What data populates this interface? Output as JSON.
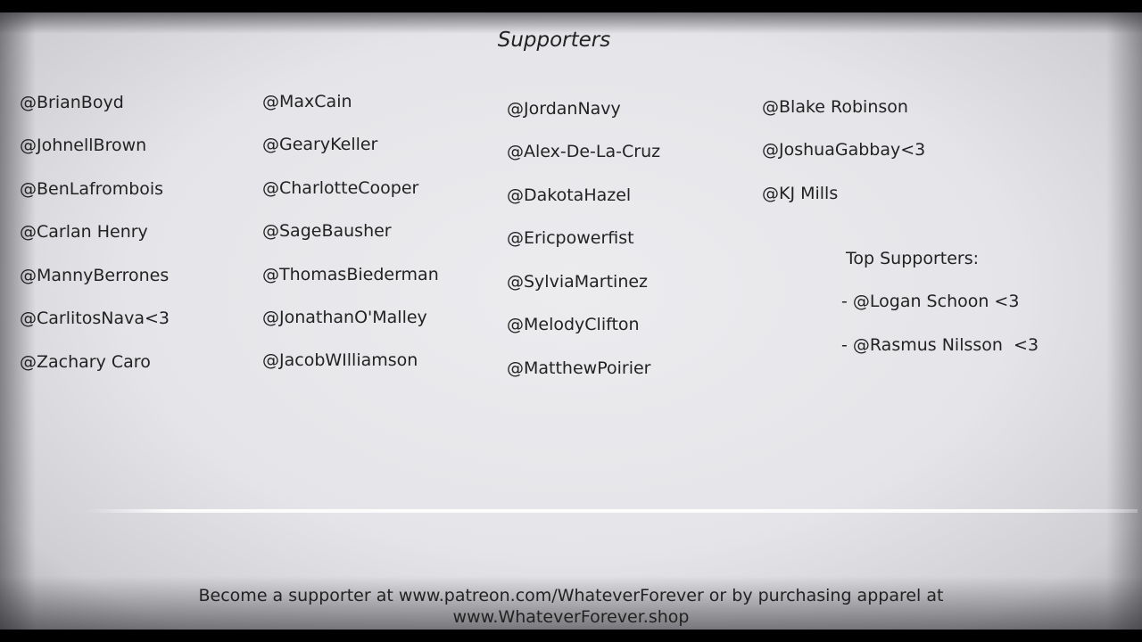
{
  "title": "Supporters",
  "columns": [
    [
      "@BrianBoyd",
      "@JohnellBrown",
      "@BenLafrombois",
      "@Carlan Henry",
      "@MannyBerrones",
      "@CarlitosNava<3",
      "@Zachary Caro"
    ],
    [
      "@MaxCain",
      "@GearyKeller",
      "@CharlotteCooper",
      "@SageBausher",
      "@ThomasBiederman",
      "@JonathanO'Malley",
      "@JacobWIlliamson"
    ],
    [
      "@JordanNavy",
      "@Alex-De-La-Cruz",
      "@DakotaHazel",
      "@Ericpowerfist",
      "@SylviaMartinez",
      "@MelodyClifton",
      "@MatthewPoirier"
    ],
    [
      "@Blake Robinson",
      "@JoshuaGabbay<3",
      "@KJ Mills"
    ]
  ],
  "top_supporters": {
    "label": "Top Supporters:",
    "items": [
      "- @Logan Schoon <3",
      "- @Rasmus Nilsson  <3"
    ]
  },
  "footer": {
    "line1": "Become a supporter at www.patreon.com/WhateverForever or by purchasing apparel at",
    "line2": "www.WhateverForever.shop"
  }
}
